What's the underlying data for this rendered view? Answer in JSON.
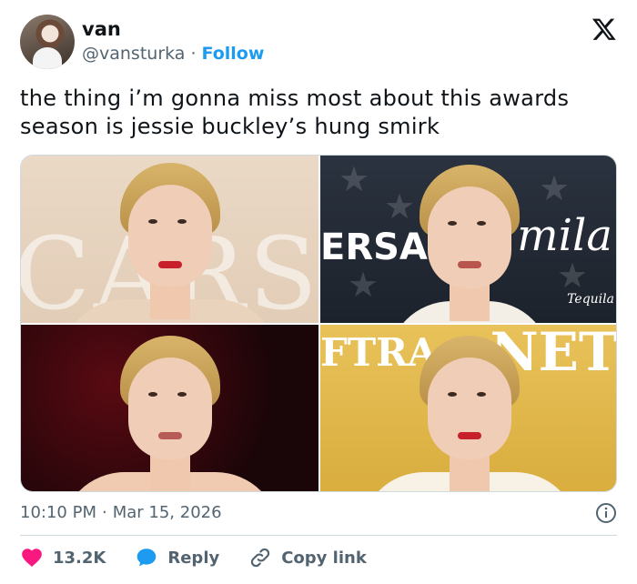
{
  "tweet": {
    "author_name": "van",
    "handle": "@vansturka",
    "separator": "·",
    "follow_label": "Follow",
    "text": "the thing i’m gonna miss most about this awards season is jessie buckley’s hung smirk",
    "timestamp_time": "10:10 PM",
    "timestamp_sep": "·",
    "timestamp_date": "Mar 15, 2026"
  },
  "photos": [
    {
      "name": "oscars",
      "bg_text": "CARS"
    },
    {
      "name": "critics-choice",
      "bg_text": "ERSA",
      "bg_text2": "mila",
      "bg_text3": "Tequila"
    },
    {
      "name": "red-carpet",
      "bg_text": ""
    },
    {
      "name": "bafta-netflix",
      "bg_text": "FTRA",
      "bg_text2": "NET"
    }
  ],
  "actions": {
    "likes": "13.2K",
    "reply_label": "Reply",
    "copy_label": "Copy link"
  },
  "colors": {
    "accent": "#1d9bf0",
    "like": "#f91880",
    "text": "#0f1419",
    "secondary": "#536471"
  }
}
